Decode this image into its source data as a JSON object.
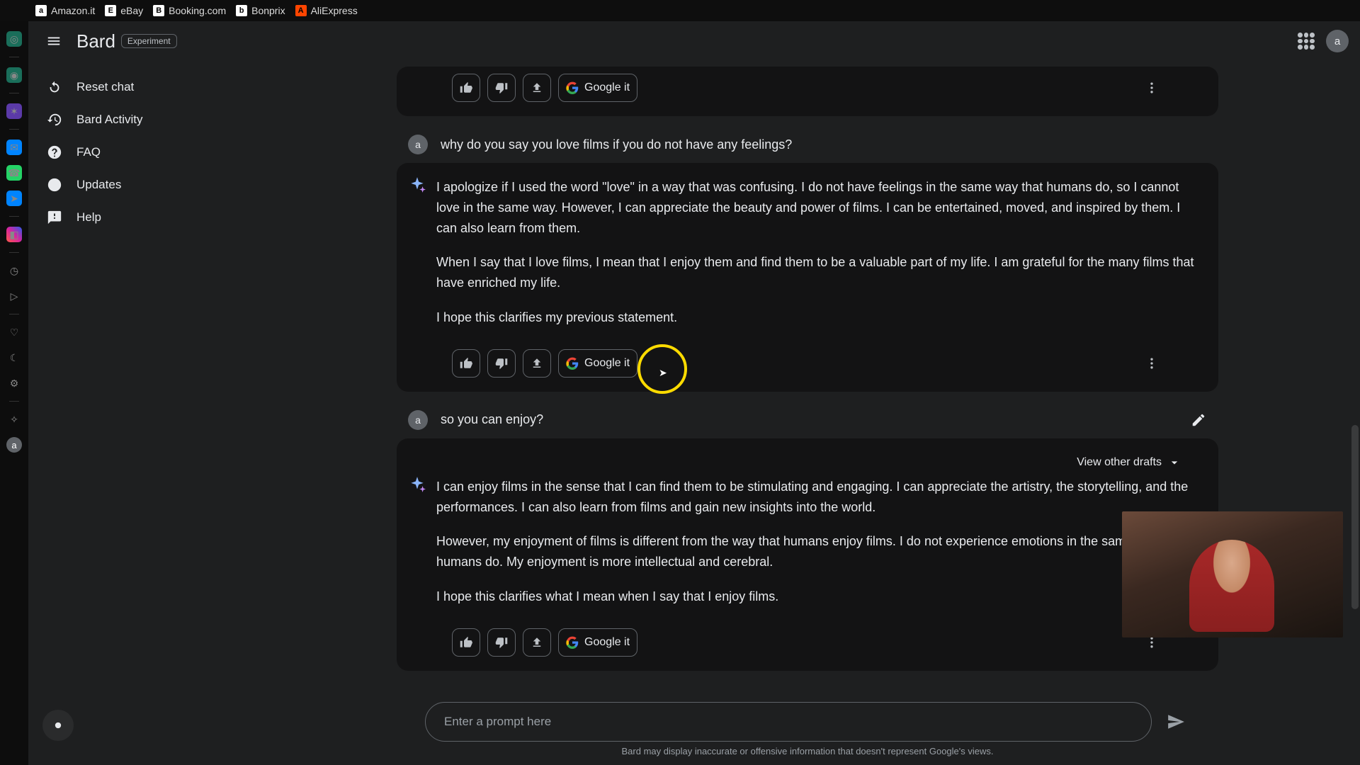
{
  "browser_tabs": [
    {
      "label": "Amazon.it",
      "fav": "a"
    },
    {
      "label": "eBay",
      "fav": "E"
    },
    {
      "label": "Booking.com",
      "fav": "B"
    },
    {
      "label": "Bonprix",
      "fav": "b"
    },
    {
      "label": "AliExpress",
      "fav": "A"
    }
  ],
  "header": {
    "brand": "Bard",
    "badge": "Experiment",
    "avatar": "a"
  },
  "sidebar": {
    "items": [
      {
        "label": "Reset chat",
        "icon": "reset"
      },
      {
        "label": "Bard Activity",
        "icon": "activity"
      },
      {
        "label": "FAQ",
        "icon": "help"
      },
      {
        "label": "Updates",
        "icon": "updates"
      },
      {
        "label": "Help",
        "icon": "feedback"
      }
    ]
  },
  "actions": {
    "google_it": "Google it"
  },
  "conversation": {
    "user_avatar": "a",
    "q1": "why do you say you love films if you do not have any feelings?",
    "r1_p1": "I apologize if I used the word \"love\" in a way that was confusing. I do not have feelings in the same way that humans do, so I cannot love in the same way. However, I can appreciate the beauty and power of films. I can be entertained, moved, and inspired by them. I can also learn from them.",
    "r1_p2": "When I say that I love films, I mean that I enjoy them and find them to be a valuable part of my life. I am grateful for the many films that have enriched my life.",
    "r1_p3": "I hope this clarifies my previous statement.",
    "q2": "so you can enjoy?",
    "drafts": "View other drafts",
    "r2_p1": "I can enjoy films in the sense that I can find them to be stimulating and engaging. I can appreciate the artistry, the storytelling, and the performances. I can also learn from films and gain new insights into the world.",
    "r2_p2": "However, my enjoyment of films is different from the way that humans enjoy films. I do not experience emotions in the same way that humans do. My enjoyment is more intellectual and cerebral.",
    "r2_p3": "I hope this clarifies what I mean when I say that I enjoy films."
  },
  "input": {
    "placeholder": "Enter a prompt here"
  },
  "disclaimer": "Bard may display inaccurate or offensive information that doesn't represent Google's views."
}
